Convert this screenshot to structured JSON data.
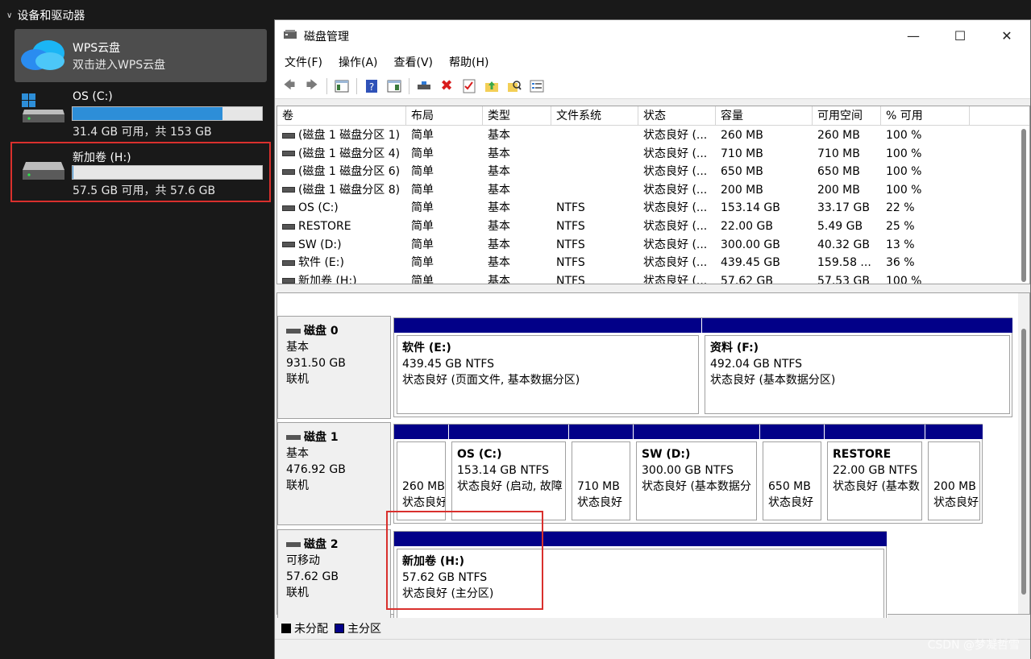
{
  "explorer": {
    "section_title": "设备和驱动器",
    "items": [
      {
        "name": "WPS云盘",
        "sub": "双击进入WPS云盘"
      },
      {
        "name": "OS (C:)",
        "info": "31.4 GB 可用，共 153 GB",
        "used_fraction": 0.79
      },
      {
        "name": "新加卷 (H:)",
        "info": "57.5 GB 可用，共 57.6 GB",
        "used_fraction": 0.002
      }
    ]
  },
  "window": {
    "title": "磁盘管理",
    "menu": [
      "文件(F)",
      "操作(A)",
      "查看(V)",
      "帮助(H)"
    ],
    "columns": [
      "卷",
      "布局",
      "类型",
      "文件系统",
      "状态",
      "容量",
      "可用空间",
      "% 可用"
    ],
    "rows": [
      [
        "(磁盘 1 磁盘分区 1)",
        "简单",
        "基本",
        "",
        "状态良好 (...",
        "260 MB",
        "260 MB",
        "100 %"
      ],
      [
        "(磁盘 1 磁盘分区 4)",
        "简单",
        "基本",
        "",
        "状态良好 (...",
        "710 MB",
        "710 MB",
        "100 %"
      ],
      [
        "(磁盘 1 磁盘分区 6)",
        "简单",
        "基本",
        "",
        "状态良好 (...",
        "650 MB",
        "650 MB",
        "100 %"
      ],
      [
        "(磁盘 1 磁盘分区 8)",
        "简单",
        "基本",
        "",
        "状态良好 (...",
        "200 MB",
        "200 MB",
        "100 %"
      ],
      [
        "OS (C:)",
        "简单",
        "基本",
        "NTFS",
        "状态良好 (...",
        "153.14 GB",
        "33.17 GB",
        "22 %"
      ],
      [
        "RESTORE",
        "简单",
        "基本",
        "NTFS",
        "状态良好 (...",
        "22.00 GB",
        "5.49 GB",
        "25 %"
      ],
      [
        "SW (D:)",
        "简单",
        "基本",
        "NTFS",
        "状态良好 (...",
        "300.00 GB",
        "40.32 GB",
        "13 %"
      ],
      [
        "软件 (E:)",
        "简单",
        "基本",
        "NTFS",
        "状态良好 (...",
        "439.45 GB",
        "159.58 ...",
        "36 %"
      ],
      [
        "新加卷 (H:)",
        "简单",
        "基本",
        "NTFS",
        "状态良好 (...",
        "57.62 GB",
        "57.53 GB",
        "100 %"
      ]
    ],
    "disks": [
      {
        "name": "磁盘 0",
        "type": "基本",
        "size": "931.50 GB",
        "status": "联机",
        "partitions": [
          {
            "title": "软件 (E:)",
            "line1": "439.45 GB NTFS",
            "line2": "状态良好 (页面文件, 基本数据分区)"
          },
          {
            "title": "资料 (F:)",
            "line1": "492.04 GB NTFS",
            "line2": "状态良好 (基本数据分区)"
          }
        ]
      },
      {
        "name": "磁盘 1",
        "type": "基本",
        "size": "476.92 GB",
        "status": "联机",
        "partitions": [
          {
            "title": "",
            "line1": "260 MB",
            "line2": "状态良好"
          },
          {
            "title": "OS (C:)",
            "line1": "153.14 GB NTFS",
            "line2": "状态良好 (启动, 故障"
          },
          {
            "title": "",
            "line1": "710 MB",
            "line2": "状态良好"
          },
          {
            "title": "SW (D:)",
            "line1": "300.00 GB NTFS",
            "line2": "状态良好 (基本数据分"
          },
          {
            "title": "",
            "line1": "650 MB",
            "line2": "状态良好"
          },
          {
            "title": "RESTORE",
            "line1": "22.00 GB NTFS",
            "line2": "状态良好 (基本数"
          },
          {
            "title": "",
            "line1": "200 MB",
            "line2": "状态良好"
          }
        ]
      },
      {
        "name": "磁盘 2",
        "type": "可移动",
        "size": "57.62 GB",
        "status": "联机",
        "partitions": [
          {
            "title": "新加卷 (H:)",
            "line1": "57.62 GB NTFS",
            "line2": "状态良好 (主分区)"
          }
        ]
      }
    ],
    "legend": [
      "未分配",
      "主分区"
    ]
  },
  "watermark": "CSDN @梦凝哲雪",
  "colors": {
    "primary_partition": "#020088",
    "highlight": "#d9302d",
    "usage_bar": "#2d8ed8"
  }
}
